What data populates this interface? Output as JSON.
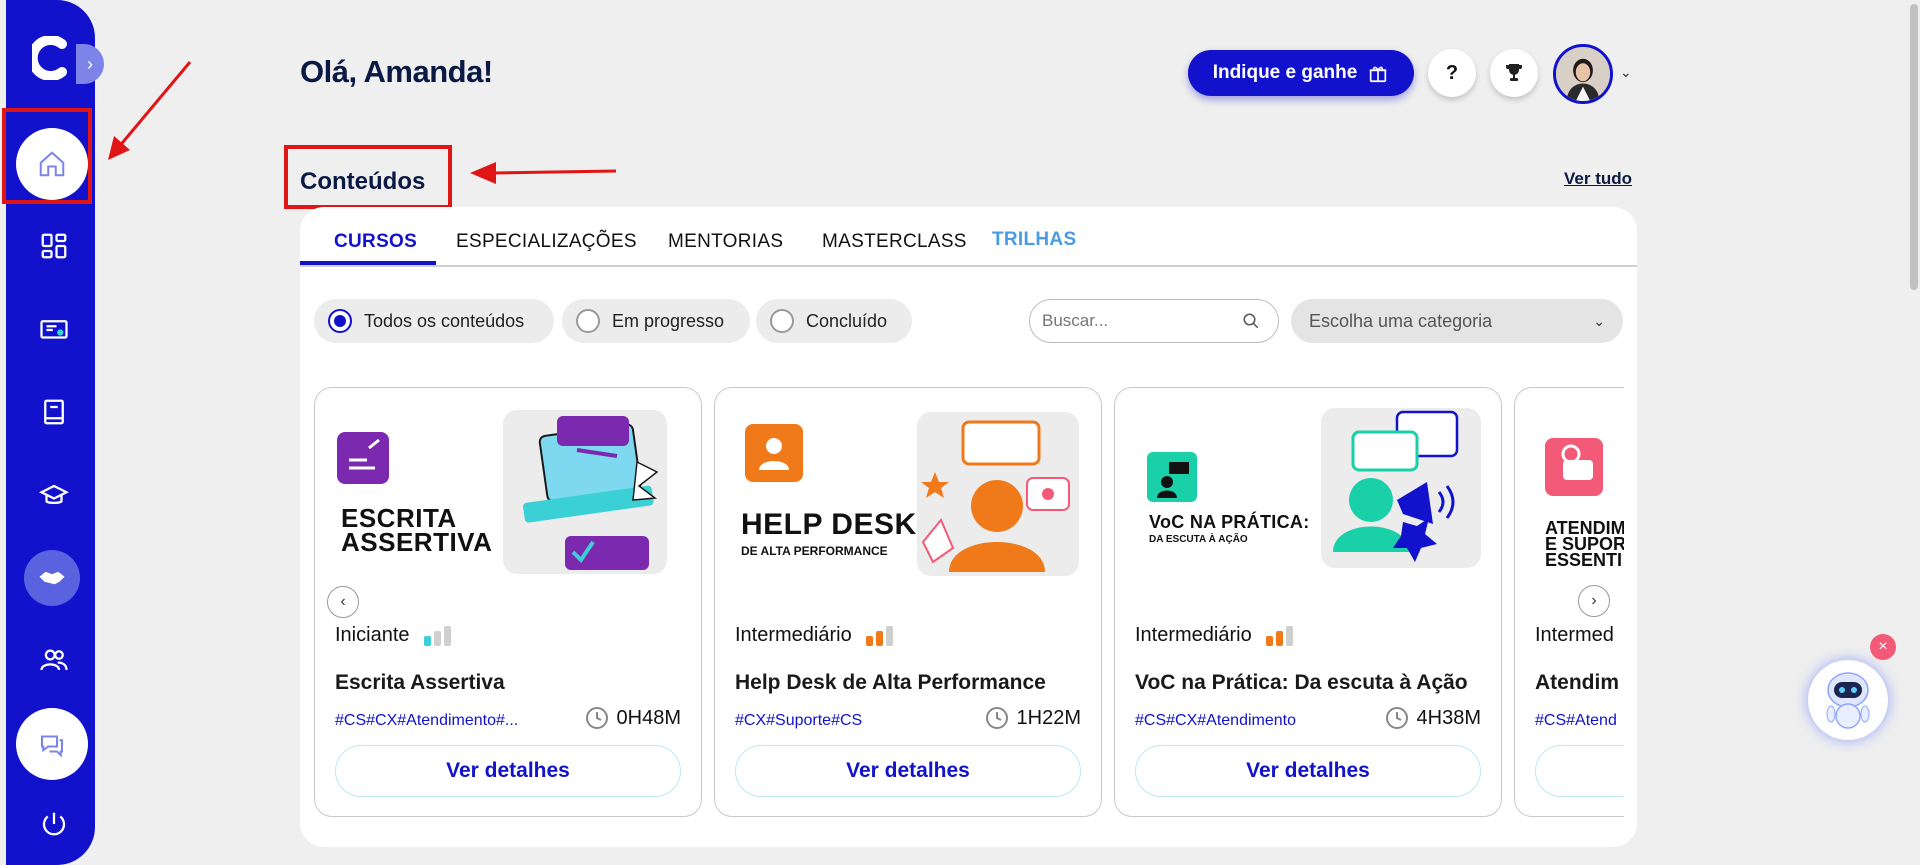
{
  "header": {
    "greeting": "Olá, Amanda!",
    "refer_label": "Indique e ganhe",
    "help_label": "?"
  },
  "section": {
    "title": "Conteúdos",
    "see_all": "Ver tudo"
  },
  "tabs": [
    {
      "label": "CURSOS",
      "active": true
    },
    {
      "label": "ESPECIALIZAÇÕES"
    },
    {
      "label": "MENTORIAS"
    },
    {
      "label": "MASTERCLASS"
    },
    {
      "label": "TRILHAS"
    }
  ],
  "filters": [
    {
      "label": "Todos os conteúdos",
      "selected": true
    },
    {
      "label": "Em progresso"
    },
    {
      "label": "Concluído"
    }
  ],
  "search": {
    "placeholder": "Buscar..."
  },
  "category": {
    "placeholder": "Escolha uma categoria"
  },
  "cards": [
    {
      "cover_line1": "ESCRITA",
      "cover_line2": "ASSERTIVA",
      "cover_sub": "",
      "level": "Iniciante",
      "level_value": 1,
      "title": "Escrita Assertiva",
      "tags": "#CS#CX#Atendimento#...",
      "duration": "0H48M",
      "button": "Ver detalhes"
    },
    {
      "cover_line1": "HELP DESK",
      "cover_line2": "",
      "cover_sub": "DE ALTA PERFORMANCE",
      "level": "Intermediário",
      "level_value": 2,
      "title": "Help Desk de Alta Performance",
      "tags": "#CX#Suporte#CS",
      "duration": "1H22M",
      "button": "Ver detalhes"
    },
    {
      "cover_line1": "VoC NA PRÁTICA:",
      "cover_line2": "",
      "cover_sub": "DA ESCUTA À AÇÃO",
      "level": "Intermediário",
      "level_value": 2,
      "title": "VoC na Prática: Da escuta à Ação",
      "tags": "#CS#CX#Atendimento",
      "duration": "4H38M",
      "button": "Ver detalhes"
    },
    {
      "cover_line1": "ATENDIM",
      "cover_line2": "E SUPOR",
      "cover_sub": "ESSENTI",
      "level": "Intermed",
      "level_value": 2,
      "title": "Atendim",
      "tags": "#CS#Atend",
      "duration": "",
      "button": ""
    }
  ],
  "colors": {
    "brand": "#1212cc",
    "level_active_1": "#3ad0d6",
    "level_active_2": "#f07a1a",
    "level_inactive": "#cfcfcf",
    "annotation": "#e01515"
  }
}
